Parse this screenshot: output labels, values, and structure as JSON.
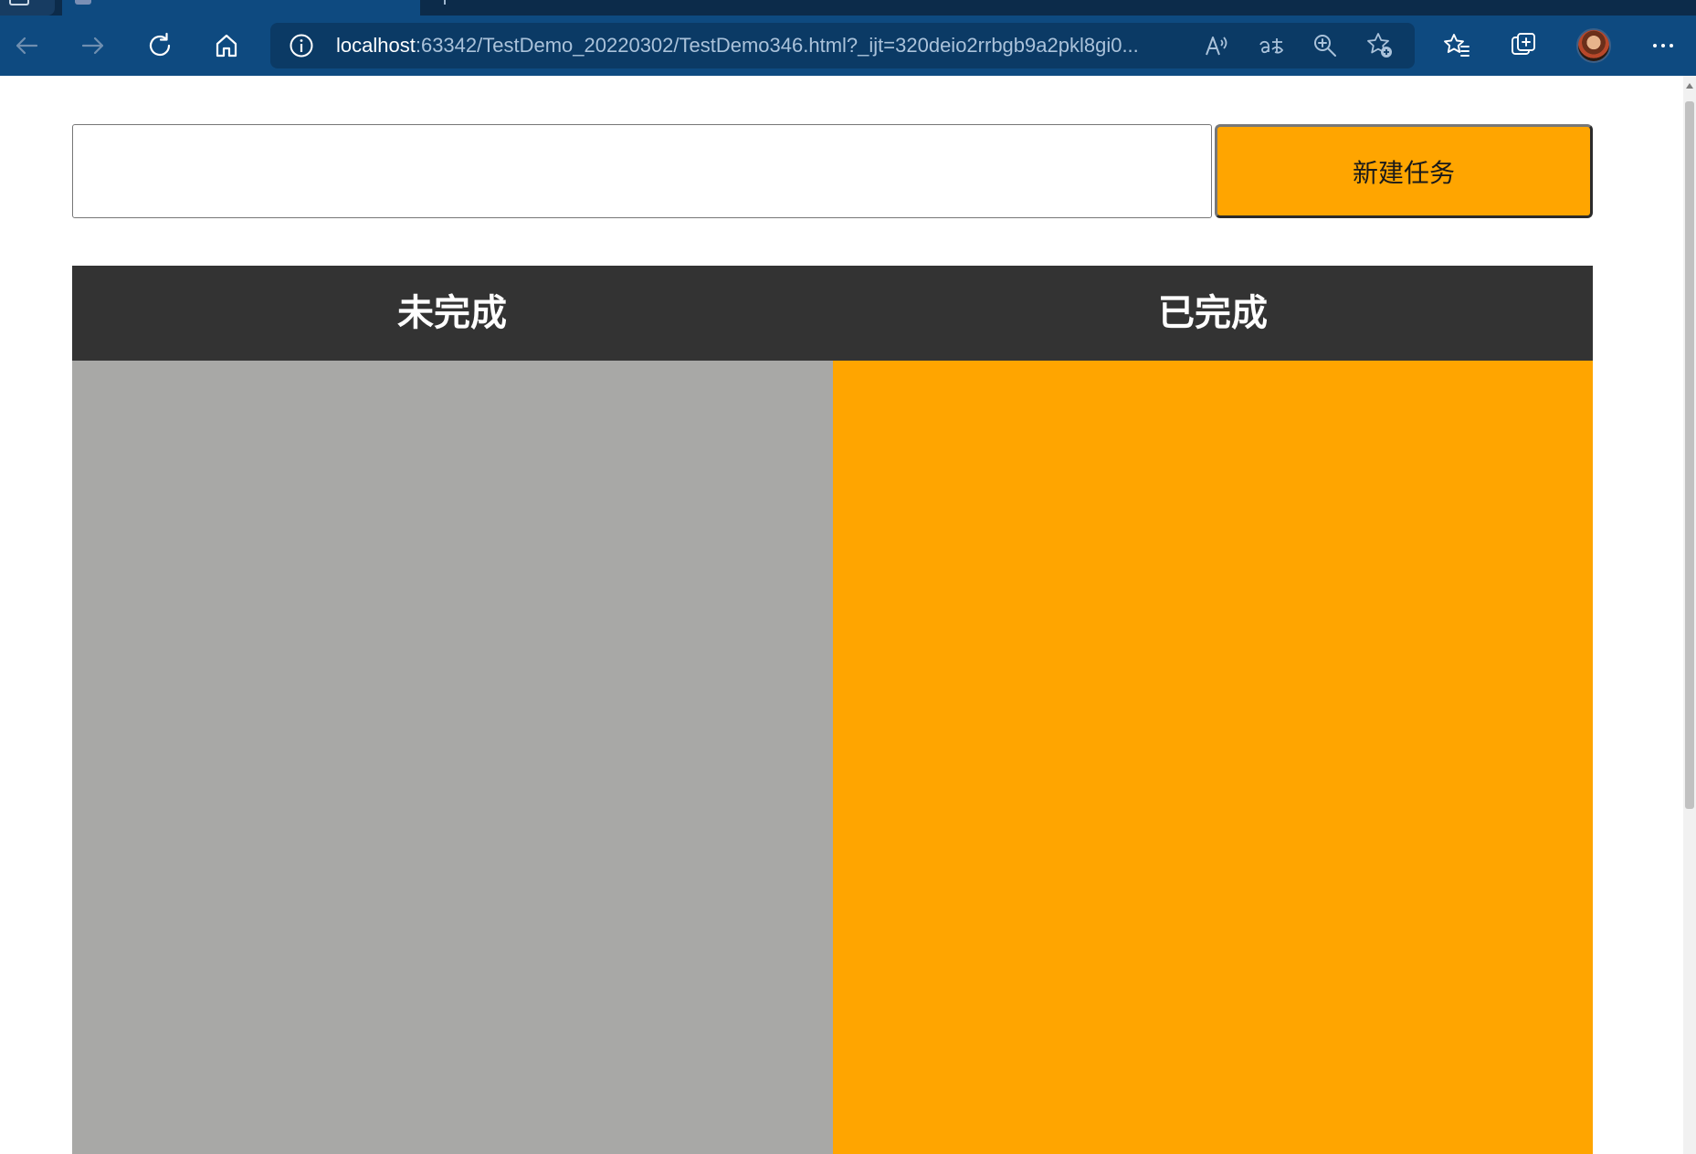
{
  "browser": {
    "url_host": "localhost",
    "url_rest": ":63342/TestDemo_20220302/TestDemo346.html?_ijt=320deio2rrbgb9a2pkl8gi0...",
    "icons": {
      "back": "back-arrow-icon",
      "forward": "forward-arrow-icon",
      "refresh": "refresh-icon",
      "home": "home-icon",
      "site_info": "info-icon",
      "read_aloud": "read-aloud-icon",
      "translate": "translate-icon",
      "zoom": "zoom-icon",
      "add_favorite": "add-favorite-icon",
      "favorites": "favorites-icon",
      "collections": "collections-icon",
      "profile": "avatar",
      "more": "more-icon"
    },
    "toolbar_color": "#0e4a80"
  },
  "todo": {
    "input_value": "",
    "new_task_label": "新建任务",
    "columns": [
      {
        "title": "未完成",
        "color": "#a8a8a6"
      },
      {
        "title": "已完成",
        "color": "#ffa500"
      }
    ],
    "header_color": "#333333",
    "button_color": "#ffa500"
  }
}
